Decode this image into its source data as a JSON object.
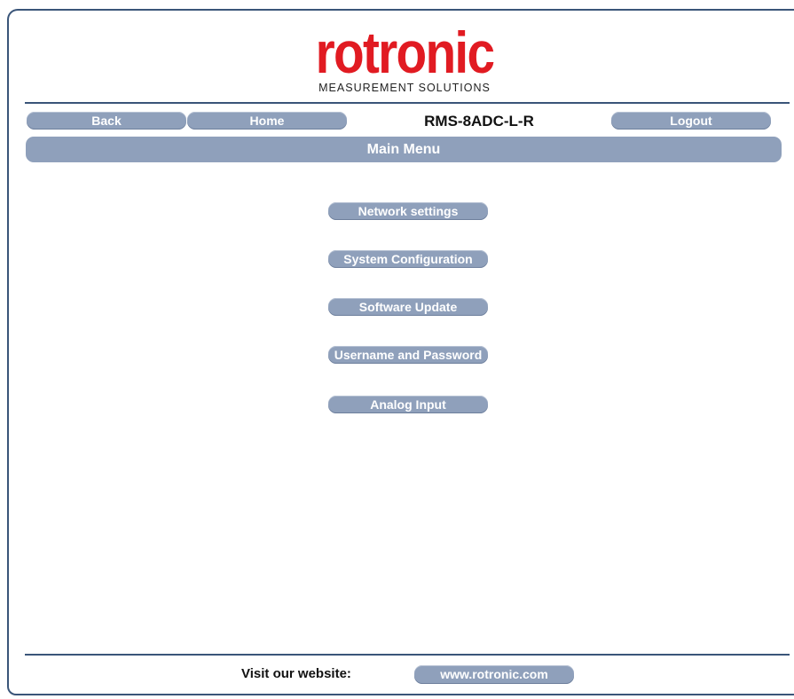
{
  "logo": {
    "wordmark": "rotronic",
    "tagline": "MEASUREMENT SOLUTIONS",
    "color": "#e11b22"
  },
  "nav": {
    "back_label": "Back",
    "home_label": "Home",
    "device_name": "RMS-8ADC-L-R",
    "logout_label": "Logout"
  },
  "page": {
    "title": "Main Menu"
  },
  "menu": {
    "items": [
      {
        "label": "Network settings"
      },
      {
        "label": "System Configuration"
      },
      {
        "label": "Software Update"
      },
      {
        "label": "Username and Password"
      },
      {
        "label": "Analog Input"
      }
    ]
  },
  "footer": {
    "label": "Visit our website:",
    "link_label": "www.rotronic.com"
  },
  "colors": {
    "button": "#8fa0bb",
    "rule": "#3a5579",
    "brand_red": "#e11b22"
  }
}
